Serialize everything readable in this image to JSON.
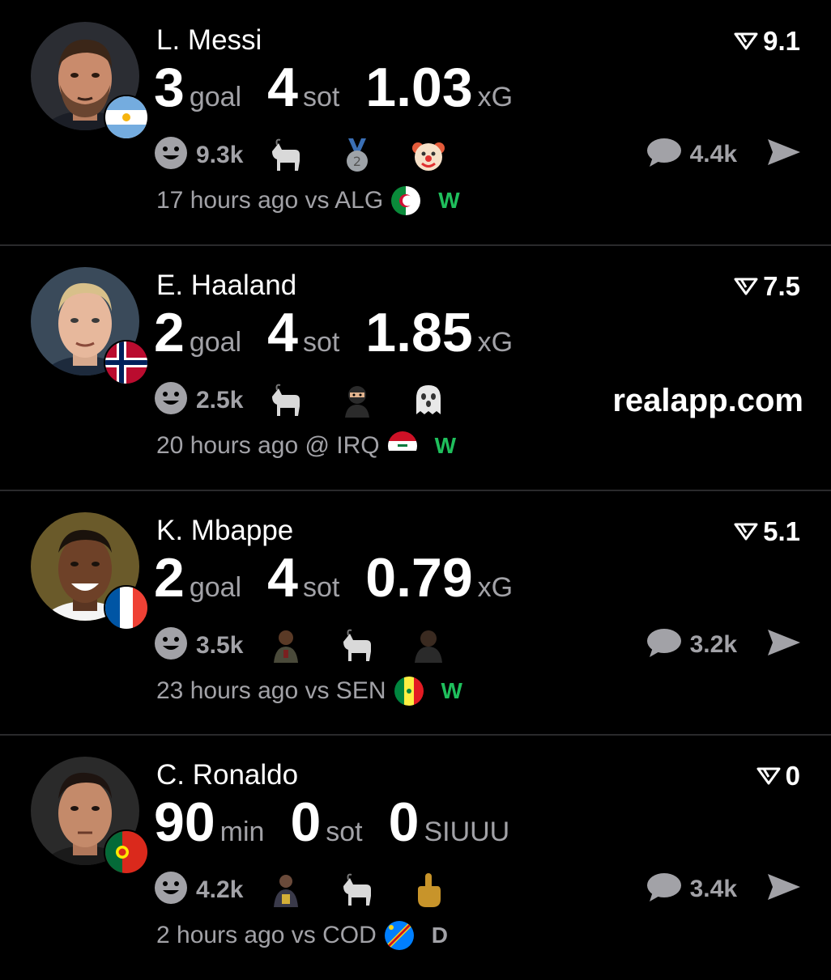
{
  "colors": {
    "background": "#000000",
    "primary_text": "#ffffff",
    "secondary_text": "#a2a2a7",
    "divider": "#2a2a2c",
    "win": "#1fbf5c",
    "draw": "#a2a2a7"
  },
  "watermark": "realapp.com",
  "cards": [
    {
      "name": "L. Messi",
      "rating": "9.1",
      "stats": [
        {
          "value": "3",
          "unit": "goal"
        },
        {
          "value": "4",
          "unit": "sot"
        },
        {
          "value": "1.03",
          "unit": "xG"
        }
      ],
      "reaction_count": "9.3k",
      "reaction_icons": [
        "goat-emoji",
        "silver-medal-emoji",
        "clown-emoji"
      ],
      "comment_count": "4.4k",
      "time": "17 hours ago vs ALG",
      "opponent_flag": "algeria-flag",
      "result": "W",
      "nation_flag": "argentina-flag"
    },
    {
      "name": "E. Haaland",
      "rating": "7.5",
      "stats": [
        {
          "value": "2",
          "unit": "goal"
        },
        {
          "value": "4",
          "unit": "sot"
        },
        {
          "value": "1.85",
          "unit": "xG"
        }
      ],
      "reaction_count": "2.5k",
      "reaction_icons": [
        "goat-emoji",
        "ninja-emoji",
        "ghost-emoji"
      ],
      "comment_count": "",
      "time": "20 hours ago @ IRQ",
      "opponent_flag": "iraq-flag",
      "result": "W",
      "nation_flag": "norway-flag"
    },
    {
      "name": "K. Mbappe",
      "rating": "5.1",
      "stats": [
        {
          "value": "2",
          "unit": "goal"
        },
        {
          "value": "4",
          "unit": "sot"
        },
        {
          "value": "0.79",
          "unit": "xG"
        }
      ],
      "reaction_count": "3.5k",
      "reaction_icons": [
        "person-emoji",
        "goat-emoji",
        "person-emoji"
      ],
      "comment_count": "3.2k",
      "time": "23 hours ago vs SEN",
      "opponent_flag": "senegal-flag",
      "result": "W",
      "nation_flag": "france-flag"
    },
    {
      "name": "C. Ronaldo",
      "rating": "0",
      "stats": [
        {
          "value": "90",
          "unit": "min"
        },
        {
          "value": "0",
          "unit": "sot"
        },
        {
          "value": "0",
          "unit": "SIUUU"
        }
      ],
      "reaction_count": "4.2k",
      "reaction_icons": [
        "trophy-person-emoji",
        "goat-emoji",
        "middle-finger-emoji"
      ],
      "comment_count": "3.4k",
      "time": "2 hours ago vs COD",
      "opponent_flag": "dr-congo-flag",
      "result": "D",
      "nation_flag": "portugal-flag"
    }
  ]
}
